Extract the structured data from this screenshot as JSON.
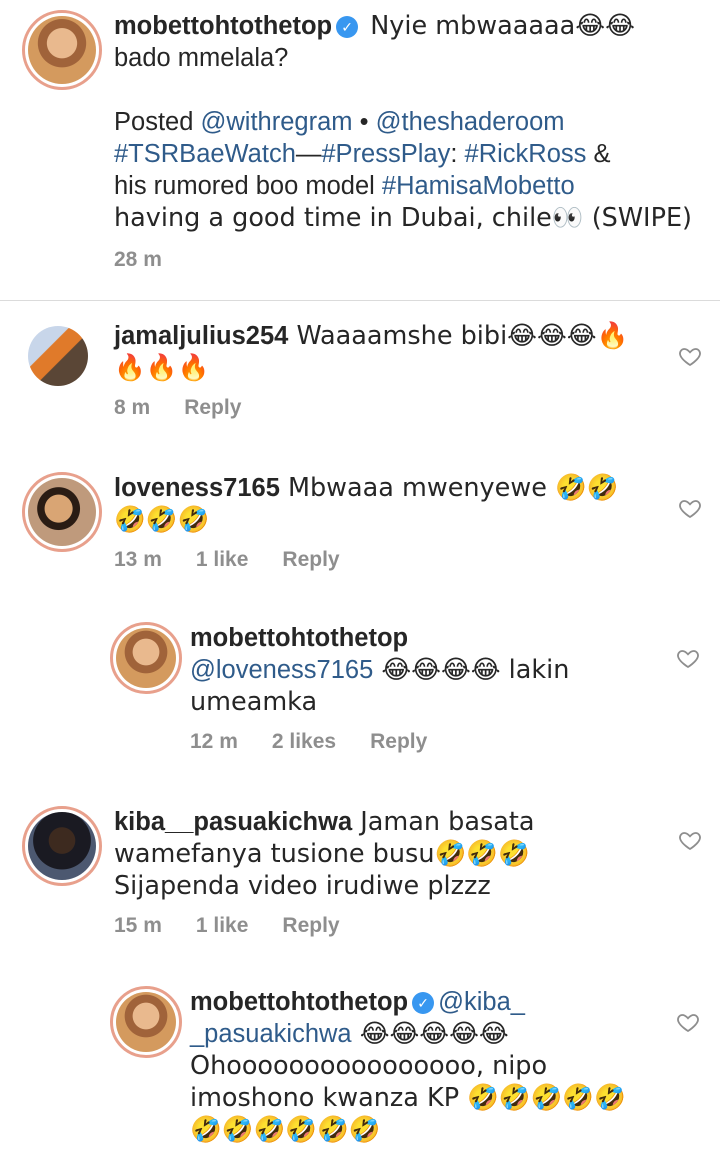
{
  "caption": {
    "username": "mobettohtothetop",
    "verified": true,
    "text_line1": " Nyie mbwaaaaa😂😂",
    "text_line2": "bado mmelala?",
    "posted_prefix": "Posted ",
    "mention1": "@withregram",
    "bullet": " • ",
    "mention2": "@theshaderoom",
    "hashtag1": "#TSRBaeWatch",
    "dash": "—",
    "hashtag2": "#PressPlay",
    "colon": ": ",
    "hashtag3": "#RickRoss",
    "amp": " &",
    "text_mid": "his  rumored boo model ",
    "hashtag4": "#HamisaMobetto",
    "text_end": "having a good time in Dubai, chile👀 (SWIPE)",
    "time": "28 m"
  },
  "comments": [
    {
      "username": "jamaljulius254",
      "text": " Waaaamshe bibi😂😂😂🔥🔥🔥🔥",
      "time": "8 m",
      "reply_label": "Reply"
    },
    {
      "username": "loveness7165",
      "text": " Mbwaaa mwenyewe 🤣🤣🤣🤣🤣",
      "time": "13 m",
      "likes": "1 like",
      "reply_label": "Reply"
    },
    {
      "username": "kiba__pasuakichwa",
      "text": " Jaman basata wamefanya tusione busu🤣🤣🤣 Sijapenda video irudiwe plzzz",
      "time": "15 m",
      "likes": "1 like",
      "reply_label": "Reply"
    }
  ],
  "replies": [
    {
      "username": "mobettohtothetop",
      "mention": "@loveness7165",
      "text": " 😂😂😂😂 lakin umeamka",
      "time": "12 m",
      "likes": "2 likes",
      "reply_label": "Reply"
    },
    {
      "username": "mobettohtothetop",
      "verified": true,
      "mention": "@kiba_ _pasuakichwa",
      "text": " 😂😂😂😂😂 Ohoooooooooooooooo, nipo imoshono kwanza KP 🤣🤣🤣🤣🤣🤣🤣🤣🤣🤣🤣"
    }
  ],
  "icons": {
    "heart": "heart-outline-icon",
    "verified": "verified-badge-icon"
  },
  "colors": {
    "link": "#2f5b8a",
    "muted": "#8e8e8e",
    "verified": "#3897f0"
  }
}
